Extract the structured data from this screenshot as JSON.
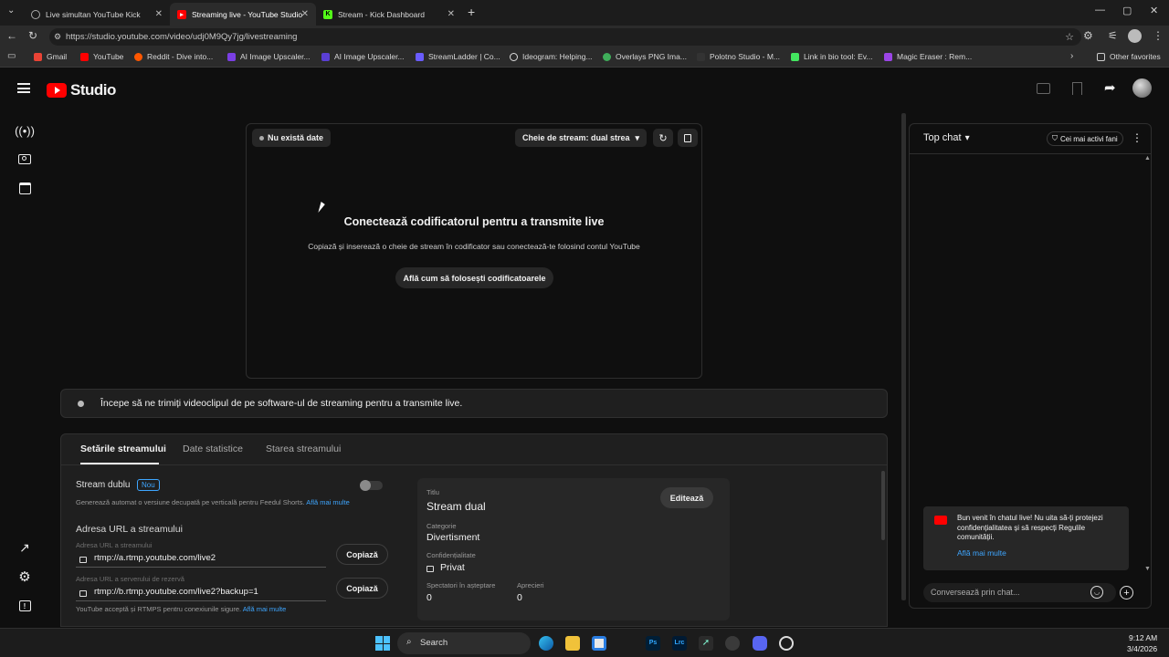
{
  "browser": {
    "tabs": [
      {
        "title": "Live simultan YouTube Kick",
        "active": false
      },
      {
        "title": "Streaming live - YouTube Studio",
        "active": true
      },
      {
        "title": "Stream - Kick Dashboard",
        "active": false
      }
    ],
    "url": "https://studio.youtube.com/video/udj0M9Qy7jg/livestreaming",
    "bookmarks": [
      "Gmail",
      "YouTube",
      "Reddit - Dive into...",
      "AI Image Upscaler...",
      "AI Image Upscaler...",
      "StreamLadder | Co...",
      "Ideogram: Helping...",
      "Overlays PNG Ima...",
      "Polotno Studio - M...",
      "Link in bio tool: Ev...",
      "Magic Eraser : Rem..."
    ],
    "other_favorites": "Other favorites"
  },
  "studio": {
    "logo_text": "Studio"
  },
  "preview": {
    "status_chip": "Nu există date",
    "stream_key_label": "Cheie de stream: dual strea",
    "heading": "Conectează codificatorul pentru a transmite live",
    "subtext": "Copiază și inserează o cheie de stream în codificator sau conectează-te folosind contul YouTube",
    "learn_button": "Află cum să folosești codificatoarele"
  },
  "banner": {
    "text": "Începe să ne trimiți videoclipul de pe software-ul de streaming pentru a transmite live."
  },
  "settings": {
    "tabs": [
      "Setările streamului",
      "Date statistice",
      "Starea streamului"
    ],
    "dual_stream_label": "Stream dublu",
    "new_badge": "Nou",
    "dual_stream_desc": "Generează automat o versiune decupată pe verticală pentru Feedul Shorts.",
    "learn_more": "Află mai multe",
    "url_heading": "Adresa URL a streamului",
    "url_label": "Adresa URL a streamului",
    "url_value": "rtmp://a.rtmp.youtube.com/live2",
    "backup_label": "Adresa URL a serverului de rezervă",
    "backup_value": "rtmp://b.rtmp.youtube.com/live2?backup=1",
    "copy_button": "Copiază",
    "rtmps_note": "YouTube acceptă și RTMPS pentru conexiunile sigure.",
    "title_label": "Titlu",
    "title_value": "Stream dual",
    "edit_button": "Editează",
    "category_label": "Categorie",
    "category_value": "Divertisment",
    "privacy_label": "Confidențialitate",
    "privacy_value": "Privat",
    "waiting_label": "Spectatori în așteptare",
    "waiting_value": "0",
    "likes_label": "Aprecieri",
    "likes_value": "0"
  },
  "chat": {
    "mode": "Top chat",
    "fans_button": "Cei mai activi fani",
    "welcome_text": "Bun venit în chatul live! Nu uita să-ți protejezi confidențialitatea și să respecți Regulile comunității.",
    "welcome_link": "Află mai multe",
    "input_placeholder": "Conversează prin chat..."
  },
  "taskbar": {
    "search_placeholder": "Search",
    "time": "9:12 AM",
    "date": "3/4/2026"
  }
}
